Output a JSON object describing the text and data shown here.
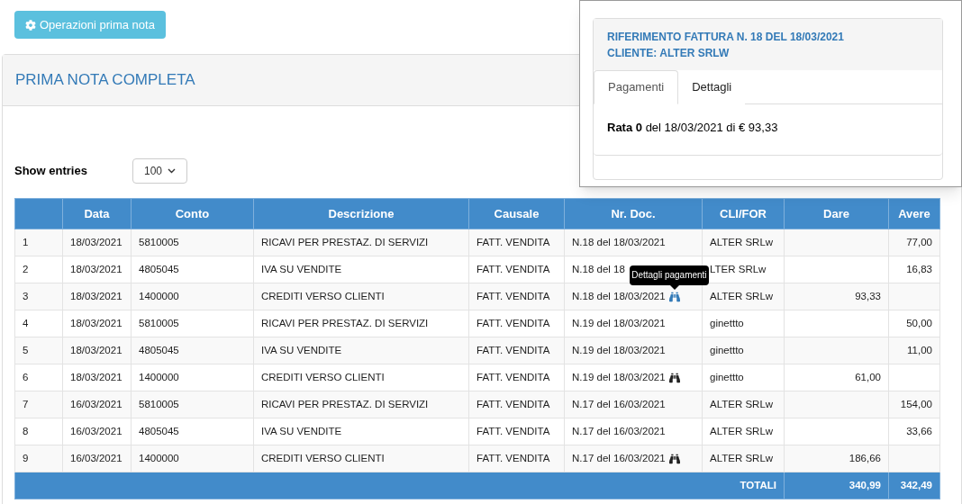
{
  "toolbar": {
    "button": "Operazioni prima nota"
  },
  "panel": {
    "title": "PRIMA NOTA COMPLETA",
    "show_entries": {
      "label": "Show entries",
      "value": "100"
    },
    "table": {
      "columns": [
        "",
        "Data",
        "Conto",
        "Descrizione",
        "Causale",
        "Nr. Doc.",
        "CLI/FOR",
        "Dare",
        "Avere"
      ],
      "rows": [
        {
          "n": "1",
          "data": "18/03/2021",
          "conto": "5810005",
          "descrizione": "RICAVI PER PRESTAZ. DI SERVIZI",
          "causale": "FATT. VENDITA",
          "doc": "N.18 del 18/03/2021",
          "clifor": "ALTER SRLw",
          "dare": "",
          "avere": "77,00"
        },
        {
          "n": "2",
          "data": "18/03/2021",
          "conto": "4805045",
          "descrizione": "IVA SU VENDITE",
          "causale": "FATT. VENDITA",
          "doc": "N.18 del 18",
          "clifor": "LTER SRLw",
          "dare": "",
          "avere": "16,83"
        },
        {
          "n": "3",
          "data": "18/03/2021",
          "conto": "1400000",
          "descrizione": "CREDITI VERSO CLIENTI",
          "causale": "FATT. VENDITA",
          "doc": "N.18 del 18/03/2021",
          "payments_link": {
            "hovered": true,
            "tooltip": "Dettagli pagamenti"
          },
          "clifor": "ALTER SRLw",
          "dare": "93,33",
          "avere": ""
        },
        {
          "n": "4",
          "data": "18/03/2021",
          "conto": "5810005",
          "descrizione": "RICAVI PER PRESTAZ. DI SERVIZI",
          "causale": "FATT. VENDITA",
          "doc": "N.19 del 18/03/2021",
          "clifor": "ginettto",
          "dare": "",
          "avere": "50,00"
        },
        {
          "n": "5",
          "data": "18/03/2021",
          "conto": "4805045",
          "descrizione": "IVA SU VENDITE",
          "causale": "FATT. VENDITA",
          "doc": "N.19 del 18/03/2021",
          "clifor": "ginettto",
          "dare": "",
          "avere": "11,00"
        },
        {
          "n": "6",
          "data": "18/03/2021",
          "conto": "1400000",
          "descrizione": "CREDITI VERSO CLIENTI",
          "causale": "FATT. VENDITA",
          "doc": "N.19 del 18/03/2021",
          "payments_link": {
            "hovered": false
          },
          "clifor": "ginettto",
          "dare": "61,00",
          "avere": ""
        },
        {
          "n": "7",
          "data": "16/03/2021",
          "conto": "5810005",
          "descrizione": "RICAVI PER PRESTAZ. DI SERVIZI",
          "causale": "FATT. VENDITA",
          "doc": "N.17 del 16/03/2021",
          "clifor": "ALTER SRLw",
          "dare": "",
          "avere": "154,00"
        },
        {
          "n": "8",
          "data": "16/03/2021",
          "conto": "4805045",
          "descrizione": "IVA SU VENDITE",
          "causale": "FATT. VENDITA",
          "doc": "N.17 del 16/03/2021",
          "clifor": "ALTER SRLw",
          "dare": "",
          "avere": "33,66"
        },
        {
          "n": "9",
          "data": "16/03/2021",
          "conto": "1400000",
          "descrizione": "CREDITI VERSO CLIENTI",
          "causale": "FATT. VENDITA",
          "doc": "N.17 del 16/03/2021",
          "payments_link": {
            "hovered": false
          },
          "clifor": "ALTER SRLw",
          "dare": "186,66",
          "avere": ""
        }
      ],
      "totals": {
        "label": "TOTALI",
        "dare": "340,99",
        "avere": "342,49"
      }
    }
  },
  "popup": {
    "title_lines": [
      "RIFERIMENTO FATTURA N. 18 DEL 18/03/2021",
      "CLIENTE: ALTER SRLW"
    ],
    "tabs": [
      {
        "label": "Pagamenti",
        "selected": true
      },
      {
        "label": "Dettagli",
        "selected": false
      }
    ],
    "content": "**Rata 0** del 18/03/2021 di € 93,33"
  }
}
